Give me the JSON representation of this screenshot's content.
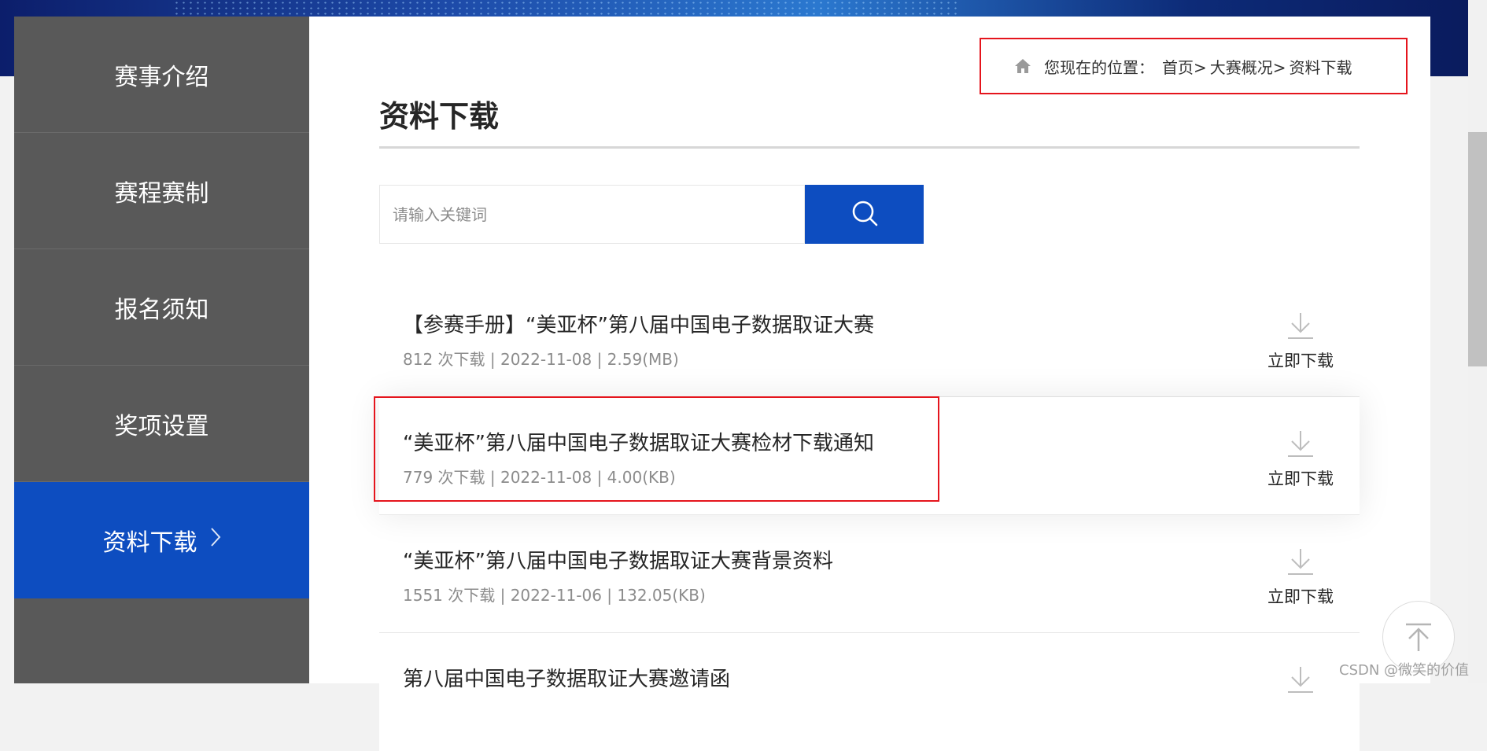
{
  "sidebar": {
    "items": [
      {
        "label": "赛事介绍"
      },
      {
        "label": "赛程赛制"
      },
      {
        "label": "报名须知"
      },
      {
        "label": "奖项设置"
      },
      {
        "label": "资料下载",
        "active": true,
        "chevron": "chevron-right-icon"
      }
    ]
  },
  "breadcrumb": {
    "prefix": "您现在的位置：",
    "items": [
      "首页>",
      "大赛概况>",
      "资料下载"
    ],
    "icon": "home-icon"
  },
  "page": {
    "title": "资料下载"
  },
  "search": {
    "placeholder": "请输入关键词",
    "value": "",
    "icon": "search-icon"
  },
  "documents": [
    {
      "title": "【参赛手册】“美亚杯”第八届中国电子数据取证大赛",
      "meta": "812 次下载 | 2022-11-08 | 2.59(MB)",
      "download_label": "立即下载"
    },
    {
      "title": "“美亚杯”第八届中国电子数据取证大赛检材下载通知",
      "meta": "779 次下载 | 2022-11-08 | 4.00(KB)",
      "download_label": "立即下载"
    },
    {
      "title": "“美亚杯”第八届中国电子数据取证大赛背景资料",
      "meta": "1551 次下载 | 2022-11-06 | 132.05(KB)",
      "download_label": "立即下载"
    },
    {
      "title": "第八届中国电子数据取证大赛邀请函",
      "meta": "",
      "download_label": ""
    }
  ],
  "watermark": "CSDN @微笑的价值",
  "colors": {
    "accent": "#0d4dc0",
    "sidebar": "#595959",
    "annotation_red": "#e5151d"
  }
}
